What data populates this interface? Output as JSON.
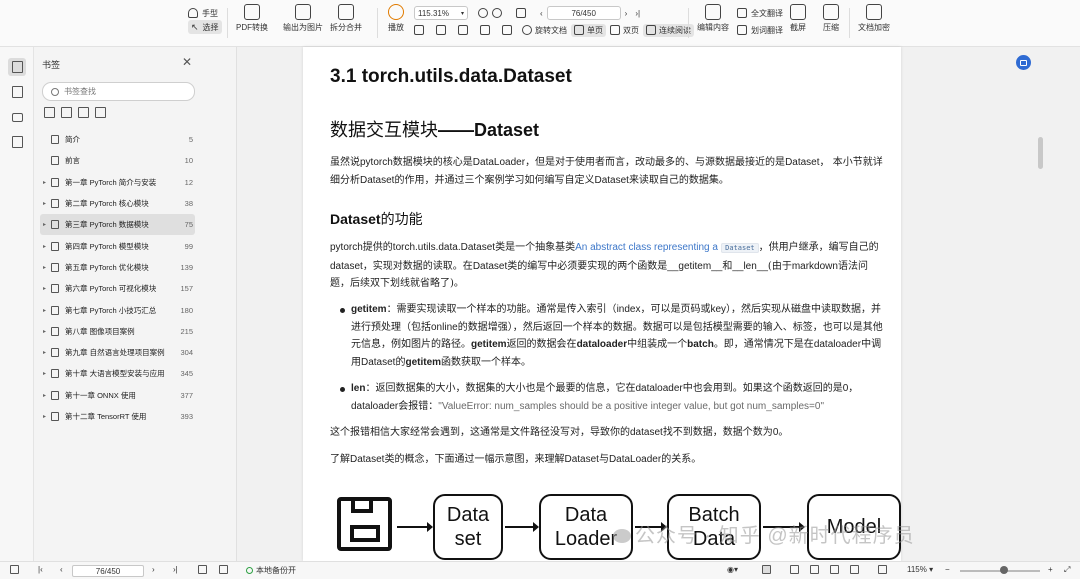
{
  "toolbar": {
    "hand_tool": "手型",
    "select_tool": "选择",
    "pdf_convert": "PDF转换",
    "export_image": "输出为图片",
    "split_merge": "拆分合并",
    "play": "播放",
    "zoom_value": "115.31%",
    "page_value": "76/450",
    "rotate_doc": "旋转文档",
    "single_page": "单页",
    "double_page": "双页",
    "continuous": "连续阅读",
    "edit_content": "编辑内容",
    "full_translate": "全文翻译",
    "word_translate": "划词翻译",
    "screenshot": "截屏",
    "compress": "压缩",
    "encrypt": "文档加密"
  },
  "bookmarks": {
    "title": "书签",
    "search_placeholder": "书签查找",
    "items": [
      {
        "label": "简介",
        "page": "5",
        "expandable": false,
        "active": false
      },
      {
        "label": "前言",
        "page": "10",
        "expandable": false,
        "active": false
      },
      {
        "label": "第一章 PyTorch 简介与安装",
        "page": "12",
        "expandable": true,
        "active": false
      },
      {
        "label": "第二章 PyTorch 核心模块",
        "page": "38",
        "expandable": true,
        "active": false
      },
      {
        "label": "第三章 PyTorch 数据模块",
        "page": "75",
        "expandable": true,
        "active": true
      },
      {
        "label": "第四章 PyTorch 模型模块",
        "page": "99",
        "expandable": true,
        "active": false
      },
      {
        "label": "第五章 PyTorch 优化模块",
        "page": "139",
        "expandable": true,
        "active": false
      },
      {
        "label": "第六章 PyTorch 可视化模块",
        "page": "157",
        "expandable": true,
        "active": false
      },
      {
        "label": "第七章 PyTorch 小技巧汇总",
        "page": "180",
        "expandable": true,
        "active": false
      },
      {
        "label": "第八章 图像项目案例",
        "page": "215",
        "expandable": true,
        "active": false
      },
      {
        "label": "第九章 自然语言处理项目案例",
        "page": "304",
        "expandable": true,
        "active": false
      },
      {
        "label": "第十章 大语言模型安装与应用",
        "page": "345",
        "expandable": true,
        "active": false
      },
      {
        "label": "第十一章 ONNX 使用",
        "page": "377",
        "expandable": true,
        "active": false
      },
      {
        "label": "第十二章 TensorRT 使用",
        "page": "393",
        "expandable": true,
        "active": false
      }
    ]
  },
  "document": {
    "h1": "3.1 torch.utils.data.Dataset",
    "h2_cn": "数据交互模块",
    "h2_en": "——Dataset",
    "intro_a": "虽然说",
    "intro_b": "pytorch",
    "intro_c": "数据模块的核心是",
    "intro_d": "DataLoader",
    "intro_e": "，但是对于使用者而言，改动最多的、与源数据最接近的是",
    "intro_f": "Dataset",
    "intro_g": "， 本小节就详细分析",
    "intro_h": "Dataset",
    "intro_i": "的作用，并通过三个案例学习如何编写自定义",
    "intro_j": "Dataset",
    "intro_k": "来读取自己的数据集。",
    "h3_en": "Dataset",
    "h3_cn": "的功能",
    "p2_a": "pytorch",
    "p2_b": "提供的",
    "p2_c": "torch.utils.data.Dataset",
    "p2_d": "类是一个抽象基类",
    "p2_link": "An abstract class representing a",
    "p2_code": "Dataset",
    "p2_e": "，供用户继承，编写自己的",
    "p2_f": "dataset",
    "p2_g": "，实现对数据的读取。在",
    "p2_h": "Dataset",
    "p2_i": "类的编写中必须要实现的两个函数是",
    "p2_j": "__getitem__",
    "p2_k": "和",
    "p2_l": "__len__",
    "p2_m": "(由于",
    "p2_n": "markdown",
    "p2_o": "语法问题，后续双下划线就省略了)。",
    "b1_term": "getitem",
    "b1_a": "：需要实现读取一个样本的功能。通常是传入索引（",
    "b1_b": "index",
    "b1_c": "，可以是页码或",
    "b1_d": "key",
    "b1_e": "），然后实现从磁盘中读取数据，并进行预处理（包括",
    "b1_f": "online",
    "b1_g": "的数据增强），然后返回一个样本的数据。数据可以是包括模型需要的输入、标签，也可以是其他元信息，例如图片的路径。",
    "b1_h": "getitem",
    "b1_i": "返回的数据会在",
    "b1_j": "dataloader",
    "b1_k": "中组装成一个",
    "b1_l": "batch",
    "b1_m": "。即，通常情况下是在",
    "b1_n": "dataloader",
    "b1_o": "中调用",
    "b1_p": "Dataset",
    "b1_q": "的",
    "b1_r": "getitem",
    "b1_s": "函数获取一个样本。",
    "b2_term": "len",
    "b2_a": "：返回数据集的大小，数据集的大小也是个最要的信息，它在",
    "b2_b": "dataloader",
    "b2_c": "中也会用到。如果这个函数返回的是",
    "b2_d": "0",
    "b2_e": "，",
    "b2_f": "dataloader",
    "b2_g": "会报错：",
    "b2_err": "\"ValueError: num_samples should be a positive integer value, but got num_samples=0\"",
    "p3_a": "这个报错相信大家经常会遇到，这通常是文件路径没写对，导致你的",
    "p3_b": "dataset",
    "p3_c": "找不到数据，数据个数为",
    "p3_d": "0",
    "p3_e": "。",
    "p4_a": "了解",
    "p4_b": "Dataset",
    "p4_c": "类的概念，下面通过一幅示意图，来理解",
    "p4_d": "Dataset",
    "p4_e": "与",
    "p4_f": "DataLoader",
    "p4_g": "的关系。",
    "diagram": {
      "box1_l1": "Data",
      "box1_l2": "set",
      "box2_l1": "Data",
      "box2_l2": "Loader",
      "box3_l1": "Batch",
      "box3_l2": "Data",
      "box4_l1": "Model"
    },
    "watermark": "公众号 · 知乎 @新时代程序员"
  },
  "statusbar": {
    "page_value": "76/450",
    "backup": "本地备份开",
    "zoom": "115%"
  }
}
